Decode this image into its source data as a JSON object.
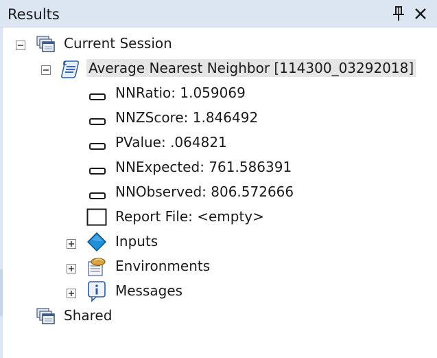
{
  "panel": {
    "title": "Results"
  },
  "tree": {
    "current_session": {
      "label": "Current Session",
      "tool": {
        "label": "Average Nearest Neighbor [114300_03292018]",
        "outputs": [
          {
            "label": "NNRatio: 1.059069"
          },
          {
            "label": "NNZScore: 1.846492"
          },
          {
            "label": "PValue: .064821"
          },
          {
            "label": "NNExpected: 761.586391"
          },
          {
            "label": "NNObserved: 806.572666"
          }
        ],
        "report_file": {
          "label": "Report File: <empty>"
        },
        "inputs": {
          "label": "Inputs"
        },
        "environments": {
          "label": "Environments"
        },
        "messages": {
          "label": "Messages"
        }
      }
    },
    "shared": {
      "label": "Shared"
    }
  },
  "icons": {
    "pin": "pin-icon",
    "close": "close-icon",
    "collapse": "minus-box-icon",
    "expand": "plus-box-icon",
    "session": "session-stack-icon",
    "tool": "script-tool-icon",
    "output": "parameter-value-icon",
    "report": "empty-box-icon",
    "inputs": "blue-diamond-icon",
    "environments": "environments-icon",
    "messages": "info-bubble-icon"
  },
  "colors": {
    "titlebar": "#dce6f3",
    "selection": "#e5e5e5",
    "text": "#1a1a1a",
    "diamond": "#1e90d8"
  }
}
